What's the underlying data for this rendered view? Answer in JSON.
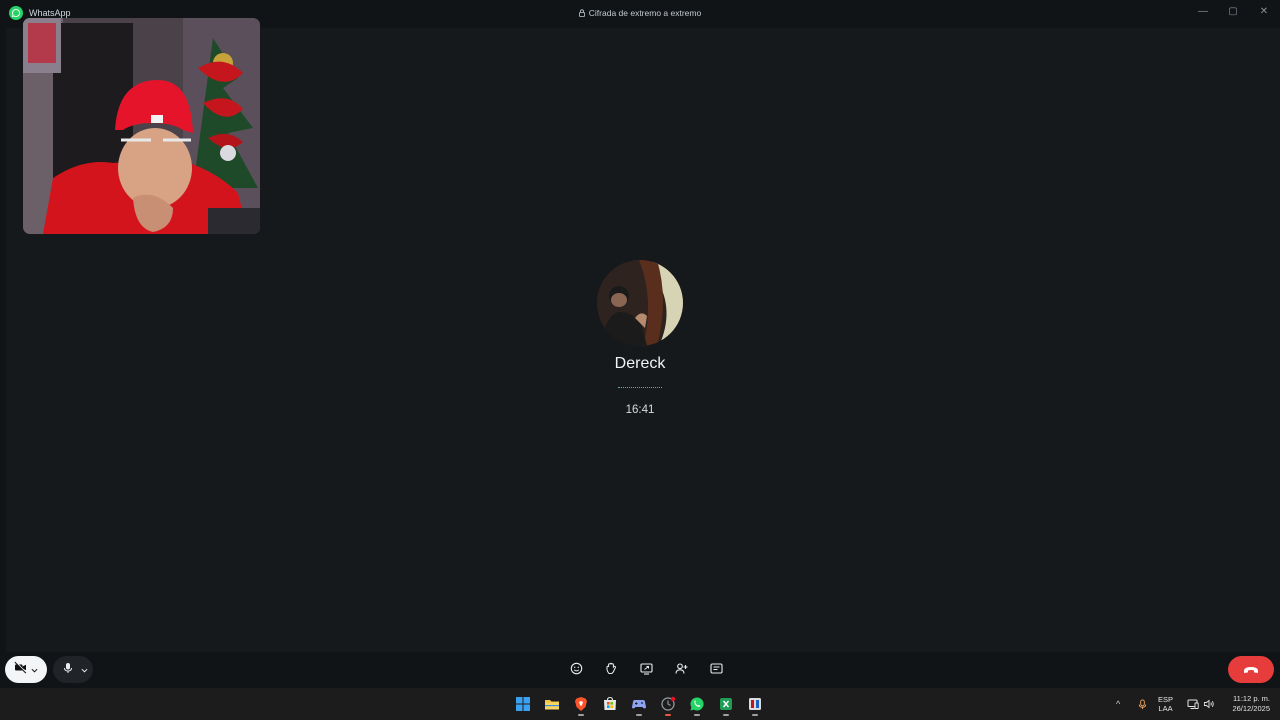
{
  "window": {
    "app_name": "WhatsApp",
    "encryption_notice": "Cifrada de extremo a extremo",
    "controls": {
      "minimize": "—",
      "maximize": "▢",
      "close": "✕"
    }
  },
  "call": {
    "contact_name": "Dereck",
    "timer": "16:41",
    "self_view": "self-camera-feed",
    "avatar": "contact-profile-photo"
  },
  "controls": {
    "camera_icon": "camera-off-icon",
    "mic_icon": "microphone-icon",
    "tools": [
      "emoji-reaction-icon",
      "raise-hand-icon",
      "screen-share-icon",
      "add-participant-icon",
      "captions-icon"
    ],
    "hangup_icon": "end-call-icon",
    "hangup_color": "#e63c3c"
  },
  "taskbar": {
    "apps": [
      "windows-start-icon",
      "file-explorer-icon",
      "brave-browser-icon",
      "microsoft-store-icon",
      "gaming-app-icon",
      "clock-app-icon",
      "whatsapp-icon",
      "spreadsheet-app-icon",
      "media-app-icon"
    ],
    "tray": {
      "overflow": "^",
      "lang_line1": "ESP",
      "lang_line2": "LAA",
      "time": "11:12 p. m.",
      "date": "26/12/2025"
    }
  },
  "colors": {
    "background": "#16191c",
    "accent": "#25d366",
    "hangup": "#e63c3c"
  }
}
